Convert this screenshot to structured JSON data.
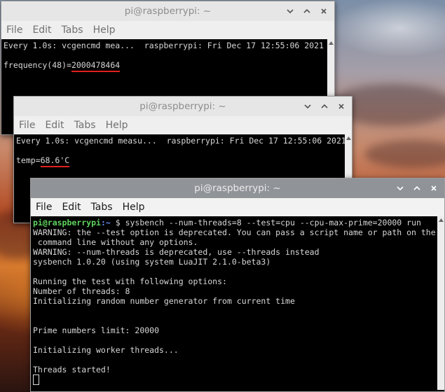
{
  "windows": [
    {
      "title": "pi@raspberrypi: ~",
      "menu": [
        "File",
        "Edit",
        "Tabs",
        "Help"
      ],
      "lines": {
        "header": "Every 1.0s: vcgencmd mea...  raspberrypi: Fri Dec 17 12:55:06 2021",
        "blank": "",
        "label": "frequency(48)=",
        "value": "2000478464"
      }
    },
    {
      "title": "pi@raspberrypi: ~",
      "menu": [
        "File",
        "Edit",
        "Tabs",
        "Help"
      ],
      "lines": {
        "header": "Every 1.0s: vcgencmd measu...  raspberrypi: Fri Dec 17 12:55:06 2021",
        "blank": "",
        "label": "temp=",
        "value": "68.6'C"
      }
    },
    {
      "title": "pi@raspberrypi: ~",
      "menu": [
        "File",
        "Edit",
        "Tabs",
        "Help"
      ],
      "prompt_user": "pi@raspberrypi",
      "prompt_path": ":~",
      "prompt_symbol": " $ ",
      "command": "sysbench --num-threads=8 --test=cpu --cpu-max-prime=20000 run",
      "output": [
        "WARNING: the --test option is deprecated. You can pass a script name or path on the",
        " command line without any options.",
        "WARNING: --num-threads is deprecated, use --threads instead",
        "sysbench 1.0.20 (using system LuaJIT 2.1.0-beta3)",
        "",
        "Running the test with following options:",
        "Number of threads: 8",
        "Initializing random number generator from current time",
        "",
        "",
        "Prime numbers limit: 20000",
        "",
        "Initializing worker threads...",
        "",
        "Threads started!",
        ""
      ]
    }
  ],
  "controls": [
    "chevron-down-icon",
    "chevron-up-icon",
    "close-icon"
  ],
  "colors": {
    "highlight_underline": "#e02020",
    "prompt_user": "#5fd35f",
    "prompt_path": "#6a8cff"
  }
}
